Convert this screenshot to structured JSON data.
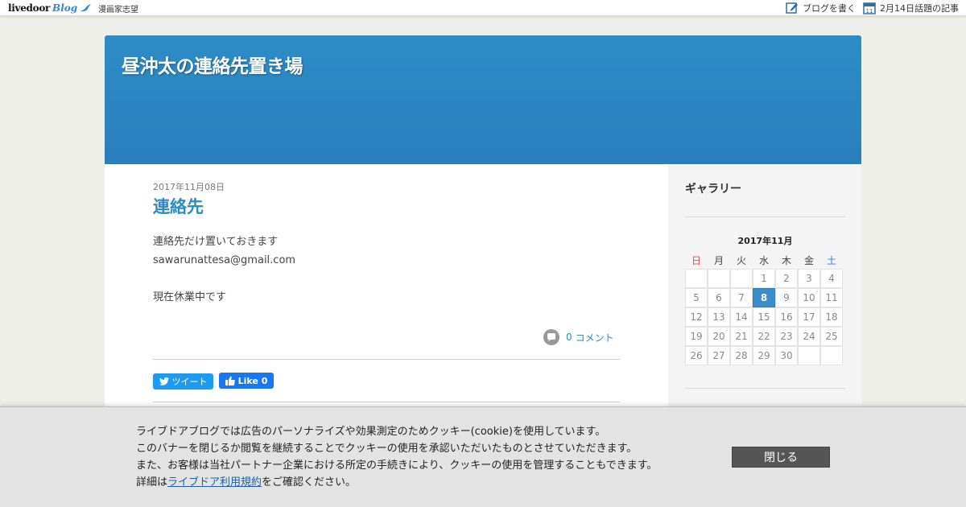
{
  "topbar": {
    "logo_text": "livedoor",
    "logo_blog": "Blog",
    "subtitle": "漫画家志望",
    "write_label": "ブログを書く",
    "topic_label": "2月14日話題の記事",
    "calendar_icon_day": "11"
  },
  "header": {
    "blog_title": "昼沖太の連絡先置き場"
  },
  "post": {
    "date": "2017年11月08日",
    "title": "連絡先",
    "lines": [
      "連絡先だけ置いておきます",
      "sawarunattesa@gmail.com",
      "",
      "現在休業中です"
    ],
    "comment_count": "0",
    "comment_label": "コメント",
    "tweet_label": "ツイート",
    "like_label": "Like 0"
  },
  "sidebar": {
    "heading": "ギャラリー",
    "calendar": {
      "title": "2017年11月",
      "weekdays": [
        "日",
        "月",
        "火",
        "水",
        "木",
        "金",
        "土"
      ],
      "weeks": [
        [
          "",
          "",
          "",
          "1",
          "2",
          "3",
          "4"
        ],
        [
          "5",
          "6",
          "7",
          "8",
          "9",
          "10",
          "11"
        ],
        [
          "12",
          "13",
          "14",
          "15",
          "16",
          "17",
          "18"
        ],
        [
          "19",
          "20",
          "21",
          "22",
          "23",
          "24",
          "25"
        ],
        [
          "26",
          "27",
          "28",
          "29",
          "30",
          "",
          ""
        ]
      ],
      "highlighted": "8"
    }
  },
  "cookie": {
    "line1": "ライブドアブログでは広告のパーソナライズや効果測定のためクッキー(cookie)を使用しています。",
    "line2": "このバナーを閉じるか閲覧を継続することでクッキーの使用を承認いただいたものとさせていただきます。",
    "line3": "また、お客様は当社パートナー企業における所定の手続きにより、クッキーの使用を管理することもできます。",
    "line4_prefix": "詳細は",
    "line4_link": "ライブドア利用規約",
    "line4_suffix": "をご確認ください。",
    "close_label": "閉じる"
  },
  "colors": {
    "accent": "#2a8bc7",
    "header_bg": "#2d8cc6",
    "today": "#3a8dc9",
    "tweet": "#1d9bf0",
    "like": "#1877f2"
  }
}
